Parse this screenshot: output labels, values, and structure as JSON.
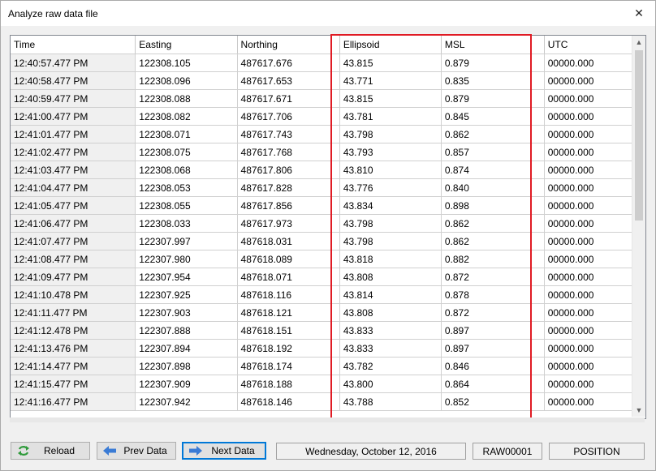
{
  "window": {
    "title": "Analyze raw data file",
    "close_glyph": "✕"
  },
  "columns": [
    "Time",
    "Easting",
    "Northing",
    "Ellipsoid",
    "MSL",
    "UTC"
  ],
  "rows": [
    [
      "12:40:57.477 PM",
      "122308.105",
      "487617.676",
      "43.815",
      "0.879",
      "00000.000"
    ],
    [
      "12:40:58.477 PM",
      "122308.096",
      "487617.653",
      "43.771",
      "0.835",
      "00000.000"
    ],
    [
      "12:40:59.477 PM",
      "122308.088",
      "487617.671",
      "43.815",
      "0.879",
      "00000.000"
    ],
    [
      "12:41:00.477 PM",
      "122308.082",
      "487617.706",
      "43.781",
      "0.845",
      "00000.000"
    ],
    [
      "12:41:01.477 PM",
      "122308.071",
      "487617.743",
      "43.798",
      "0.862",
      "00000.000"
    ],
    [
      "12:41:02.477 PM",
      "122308.075",
      "487617.768",
      "43.793",
      "0.857",
      "00000.000"
    ],
    [
      "12:41:03.477 PM",
      "122308.068",
      "487617.806",
      "43.810",
      "0.874",
      "00000.000"
    ],
    [
      "12:41:04.477 PM",
      "122308.053",
      "487617.828",
      "43.776",
      "0.840",
      "00000.000"
    ],
    [
      "12:41:05.477 PM",
      "122308.055",
      "487617.856",
      "43.834",
      "0.898",
      "00000.000"
    ],
    [
      "12:41:06.477 PM",
      "122308.033",
      "487617.973",
      "43.798",
      "0.862",
      "00000.000"
    ],
    [
      "12:41:07.477 PM",
      "122307.997",
      "487618.031",
      "43.798",
      "0.862",
      "00000.000"
    ],
    [
      "12:41:08.477 PM",
      "122307.980",
      "487618.089",
      "43.818",
      "0.882",
      "00000.000"
    ],
    [
      "12:41:09.477 PM",
      "122307.954",
      "487618.071",
      "43.808",
      "0.872",
      "00000.000"
    ],
    [
      "12:41:10.478 PM",
      "122307.925",
      "487618.116",
      "43.814",
      "0.878",
      "00000.000"
    ],
    [
      "12:41:11.477 PM",
      "122307.903",
      "487618.121",
      "43.808",
      "0.872",
      "00000.000"
    ],
    [
      "12:41:12.478 PM",
      "122307.888",
      "487618.151",
      "43.833",
      "0.897",
      "00000.000"
    ],
    [
      "12:41:13.476 PM",
      "122307.894",
      "487618.192",
      "43.833",
      "0.897",
      "00000.000"
    ],
    [
      "12:41:14.477 PM",
      "122307.898",
      "487618.174",
      "43.782",
      "0.846",
      "00000.000"
    ],
    [
      "12:41:15.477 PM",
      "122307.909",
      "487618.188",
      "43.800",
      "0.864",
      "00000.000"
    ],
    [
      "12:41:16.477 PM",
      "122307.942",
      "487618.146",
      "43.788",
      "0.852",
      "00000.000"
    ]
  ],
  "toolbar": {
    "reload_label": "Reload",
    "prev_label": "Prev Data",
    "next_label": "Next Data"
  },
  "status": {
    "date": "Wednesday, October 12, 2016",
    "file": "RAW00001",
    "mode": "POSITION"
  },
  "colors": {
    "highlight": "#e01b24",
    "focus": "#0078d7"
  }
}
